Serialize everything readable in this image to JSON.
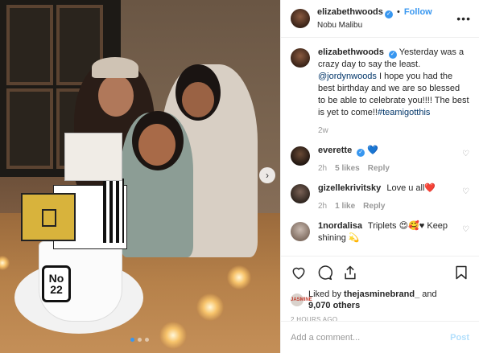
{
  "header": {
    "username": "elizabethwoods",
    "follow_label": "Follow",
    "separator": "•",
    "location": "Nobu Malibu",
    "more_icon": "more-options-icon"
  },
  "photo": {
    "cake_number": "No 22",
    "next_icon": "chevron-right-icon"
  },
  "caption": {
    "username": "elizabethwoods",
    "text_before": "Yesterday was a crazy day to say the least.",
    "mention": "@jordynwoods",
    "text_after": "I hope you had the best birthday and we are so blessed to be able to celebrate you!!!! The best is yet to come!!",
    "hashtag": "#teamigotthis",
    "time": "2w"
  },
  "comments": [
    {
      "username": "everette",
      "text": "💙",
      "time": "2h",
      "likes": "5 likes",
      "reply": "Reply"
    },
    {
      "username": "gizellekrivitsky",
      "text": "Love u all❤️",
      "time": "2h",
      "likes": "1 like",
      "reply": "Reply"
    },
    {
      "username": "1nordalisa",
      "text": "Triplets 😍🥰♥ Keep shining 💫"
    }
  ],
  "actions": {
    "liked_by_prefix": "Liked by",
    "liked_by_user": "thejasminebrand_",
    "and": "and",
    "others": "9,070 others",
    "mini_avatar_text": "JASMINE",
    "timestamp": "2 HOURS AGO"
  },
  "add_comment": {
    "placeholder": "Add a comment...",
    "post_label": "Post"
  },
  "colors": {
    "accent": "#3897f0",
    "text": "#262626",
    "muted": "#999999",
    "post_disabled": "#b2dffc"
  }
}
